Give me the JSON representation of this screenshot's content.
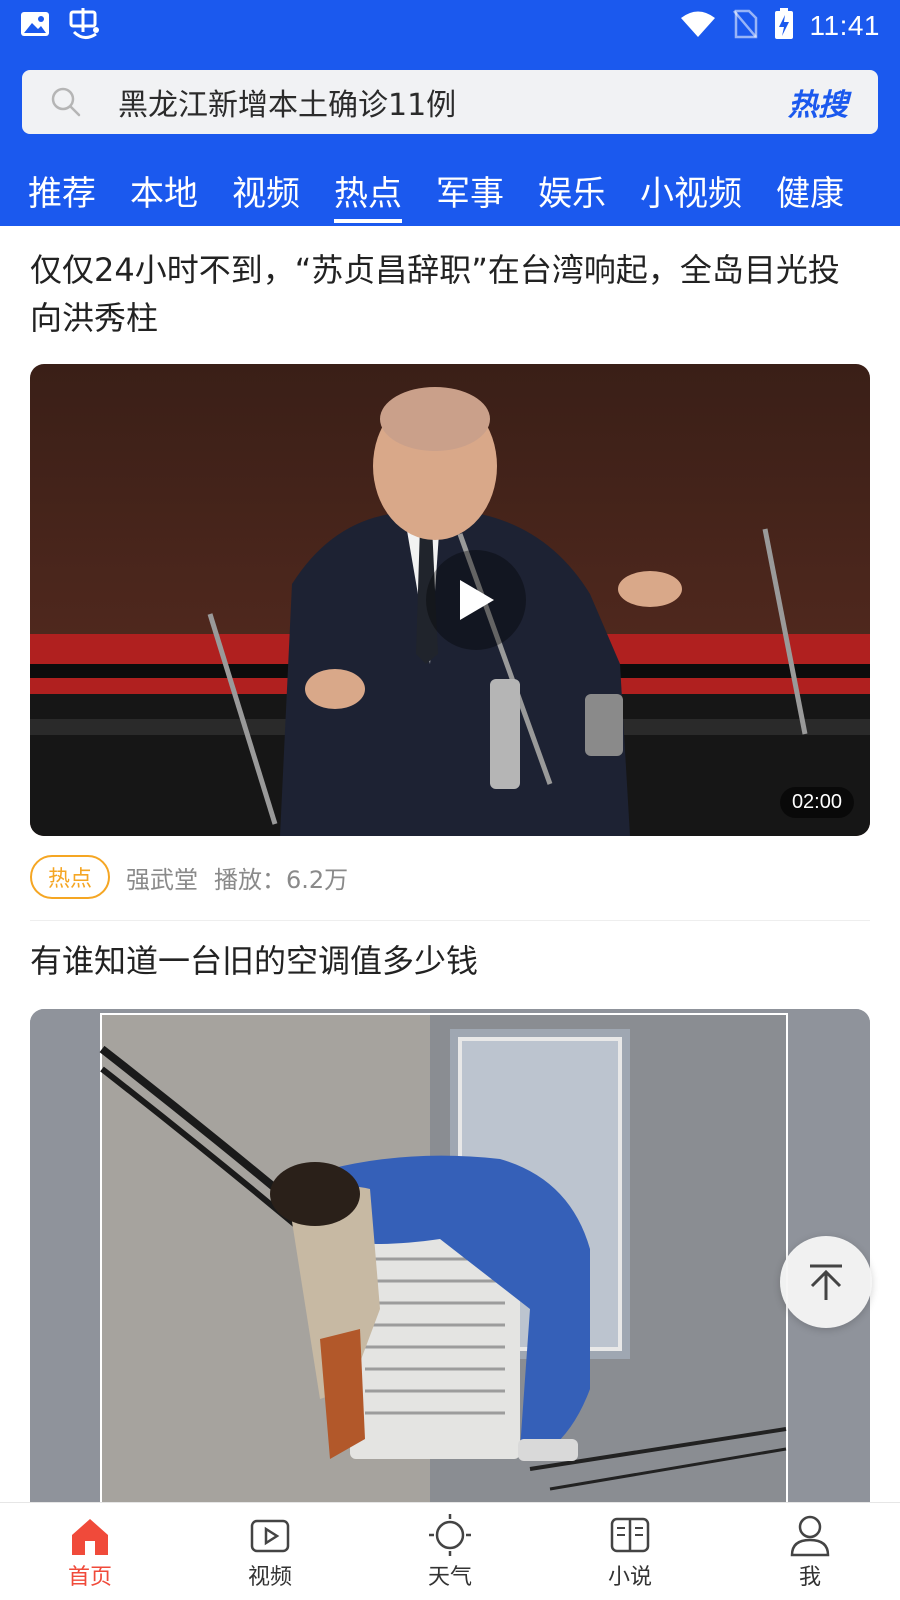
{
  "status_bar": {
    "time": "11:41",
    "left_icons": [
      "image-icon",
      "app-logo"
    ],
    "right_icons": [
      "wifi-icon",
      "no-sim-icon",
      "battery-charging-icon"
    ]
  },
  "search": {
    "query": "黑龙江新增本土确诊11例",
    "hot_label": "热搜"
  },
  "tabs": [
    {
      "label": "推荐"
    },
    {
      "label": "本地"
    },
    {
      "label": "视频"
    },
    {
      "label": "热点",
      "active": true
    },
    {
      "label": "军事"
    },
    {
      "label": "娱乐"
    },
    {
      "label": "小视频"
    },
    {
      "label": "健康"
    }
  ],
  "feed": [
    {
      "title": "仅仅24小时不到，“苏贞昌辞职”在台湾响起，全岛目光投向洪秀柱",
      "duration": "02:00",
      "tag": "热点",
      "source": "强武堂",
      "plays": "播放：6.2万"
    },
    {
      "title": "有谁知道一台旧的空调值多少钱"
    }
  ],
  "bottom_nav": [
    {
      "label": "首页",
      "icon": "home-icon",
      "active": true
    },
    {
      "label": "视频",
      "icon": "video-icon"
    },
    {
      "label": "天气",
      "icon": "weather-sun-icon"
    },
    {
      "label": "小说",
      "icon": "book-icon"
    },
    {
      "label": "我",
      "icon": "user-icon"
    }
  ],
  "colors": {
    "brand_blue": "#1b59ee",
    "hot_tag": "#f5a623",
    "active_nav": "#f04a3a"
  }
}
